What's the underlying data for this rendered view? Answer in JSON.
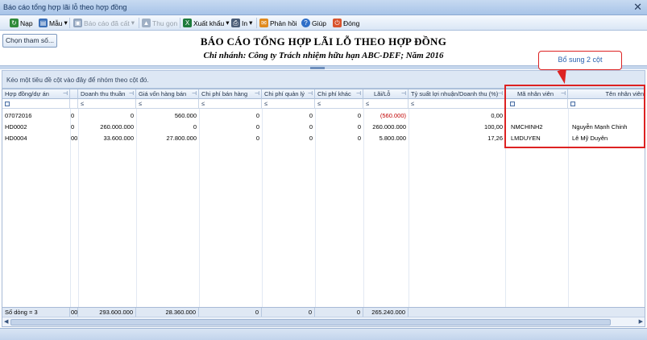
{
  "window": {
    "title": "Báo cáo tổng hợp lãi lỗ theo hợp đồng",
    "close": "✕"
  },
  "toolbar": {
    "items": [
      {
        "label": "Nạp",
        "icon": "refresh-icon",
        "color": "#2f8a3a",
        "glyph": "↻",
        "enabled": true
      },
      {
        "label": "Mẫu",
        "icon": "template-icon",
        "color": "#3a6fb7",
        "glyph": "▤",
        "enabled": true,
        "dropdown": true
      },
      {
        "label": "Báo cáo đã cất",
        "icon": "save-icon",
        "color": "#8fa3bd",
        "glyph": "▣",
        "enabled": false,
        "dropdown": true
      },
      {
        "label": "Thu gọn",
        "icon": "collapse-icon",
        "color": "#9fb0c5",
        "glyph": "▲",
        "enabled": false
      },
      {
        "label": "Xuất khẩu",
        "icon": "export-excel-icon",
        "color": "#1e7b3c",
        "glyph": "X",
        "enabled": true,
        "dropdown": true
      },
      {
        "label": "In",
        "icon": "print-icon",
        "color": "#4a5d78",
        "glyph": "⎙",
        "enabled": true,
        "dropdown": true
      },
      {
        "label": "Phản hồi",
        "icon": "mail-icon",
        "color": "#e08a1e",
        "glyph": "✉",
        "enabled": true
      },
      {
        "label": "Giúp",
        "icon": "help-icon",
        "color": "#2f6fc8",
        "glyph": "?",
        "enabled": true
      },
      {
        "label": "Đóng",
        "icon": "close-icon",
        "color": "#d9532c",
        "glyph": "⏻",
        "enabled": true
      }
    ],
    "dropdown_glyph": "▾"
  },
  "params_button": "Chọn tham số...",
  "report": {
    "title": "BÁO CÁO TỔNG HỢP LÃI LỖ THEO HỢP ĐỒNG",
    "subtitle": "Chi nhánh: Công ty Trách nhiệm hữu hạn ABC-DEF; Năm 2016"
  },
  "group_hint": "Kéo một tiêu đề cột vào đây để nhóm theo cột đó.",
  "grid": {
    "columns": [
      "Hợp đồng/dự án",
      "Doanh thu thuần",
      "Giá vốn hàng bán",
      "Chi phí bán hàng",
      "Chi phí quản lý",
      "Chi phí khác",
      "Lãi/Lỗ",
      "Tỷ suất lợi nhuận/Doanh thu (%)",
      "Mã nhân viên",
      "Tên nhân viên"
    ],
    "filter_le": "≤",
    "pin_glyph": "⊣",
    "rows": [
      {
        "contract": "07072016",
        "prefix": "0",
        "revenue": "0",
        "cogs": "560.000",
        "selling": "0",
        "admin": "0",
        "other": "0",
        "profit": "(560.000)",
        "ratio": "0,00",
        "emp_code": "",
        "emp_name": ""
      },
      {
        "contract": "HD0002",
        "prefix": "0",
        "revenue": "260.000.000",
        "cogs": "0",
        "selling": "0",
        "admin": "0",
        "other": "0",
        "profit": "260.000.000",
        "ratio": "100,00",
        "emp_code": "NMCHINH2",
        "emp_name": "Nguyễn Mạnh Chinh"
      },
      {
        "contract": "HD0004",
        "prefix": "00",
        "revenue": "33.600.000",
        "cogs": "27.800.000",
        "selling": "0",
        "admin": "0",
        "other": "0",
        "profit": "5.800.000",
        "ratio": "17,26",
        "emp_code": "LMDUYEN",
        "emp_name": "Lê Mỹ Duyên"
      }
    ],
    "footer": {
      "count": "Số dòng = 3",
      "prefix": "00",
      "revenue": "293.600.000",
      "cogs": "28.360.000",
      "selling": "0",
      "admin": "0",
      "other": "0",
      "profit": "265.240.000"
    },
    "scroll_left": "◀",
    "scroll_right": "▶"
  },
  "annotation": {
    "label": "Bổ sung 2 cột",
    "color": "#dd2222"
  }
}
